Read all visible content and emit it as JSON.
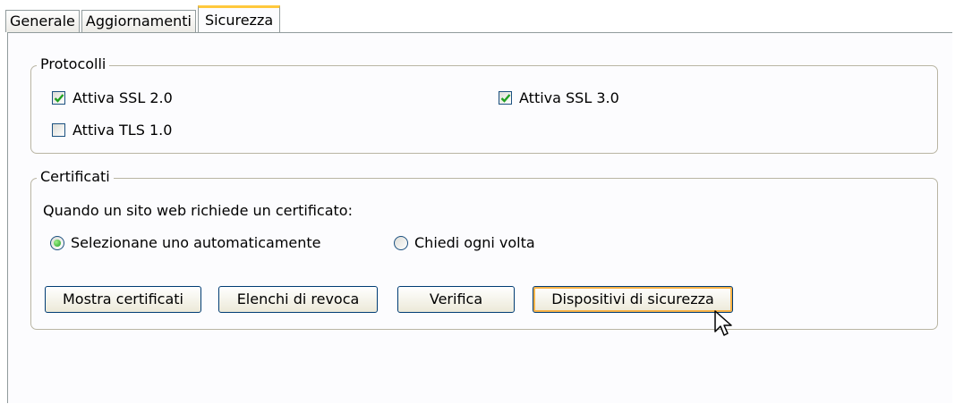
{
  "tabs": [
    {
      "label": "Generale"
    },
    {
      "label": "Aggiornamenti"
    },
    {
      "label": "Sicurezza",
      "active": true
    }
  ],
  "protocols": {
    "legend": "Protocolli",
    "ssl2": {
      "label": "Attiva SSL 2.0",
      "checked": true
    },
    "ssl3": {
      "label": "Attiva SSL 3.0",
      "checked": true
    },
    "tls1": {
      "label": "Attiva TLS 1.0",
      "checked": false
    }
  },
  "certificates": {
    "legend": "Certificati",
    "prompt": "Quando un sito web richiede un certificato:",
    "radio_auto": {
      "label": "Selezionane uno automaticamente",
      "selected": true
    },
    "radio_ask": {
      "label": "Chiedi ogni volta",
      "selected": false
    },
    "buttons": {
      "show": "Mostra certificati",
      "revocation": "Elenchi di revoca",
      "verify": "Verifica",
      "devices": "Dispositivi di sicurezza"
    }
  },
  "colors": {
    "tab_accent": "#ffc83c",
    "check_green": "#21a121",
    "button_border": "#003c74"
  }
}
